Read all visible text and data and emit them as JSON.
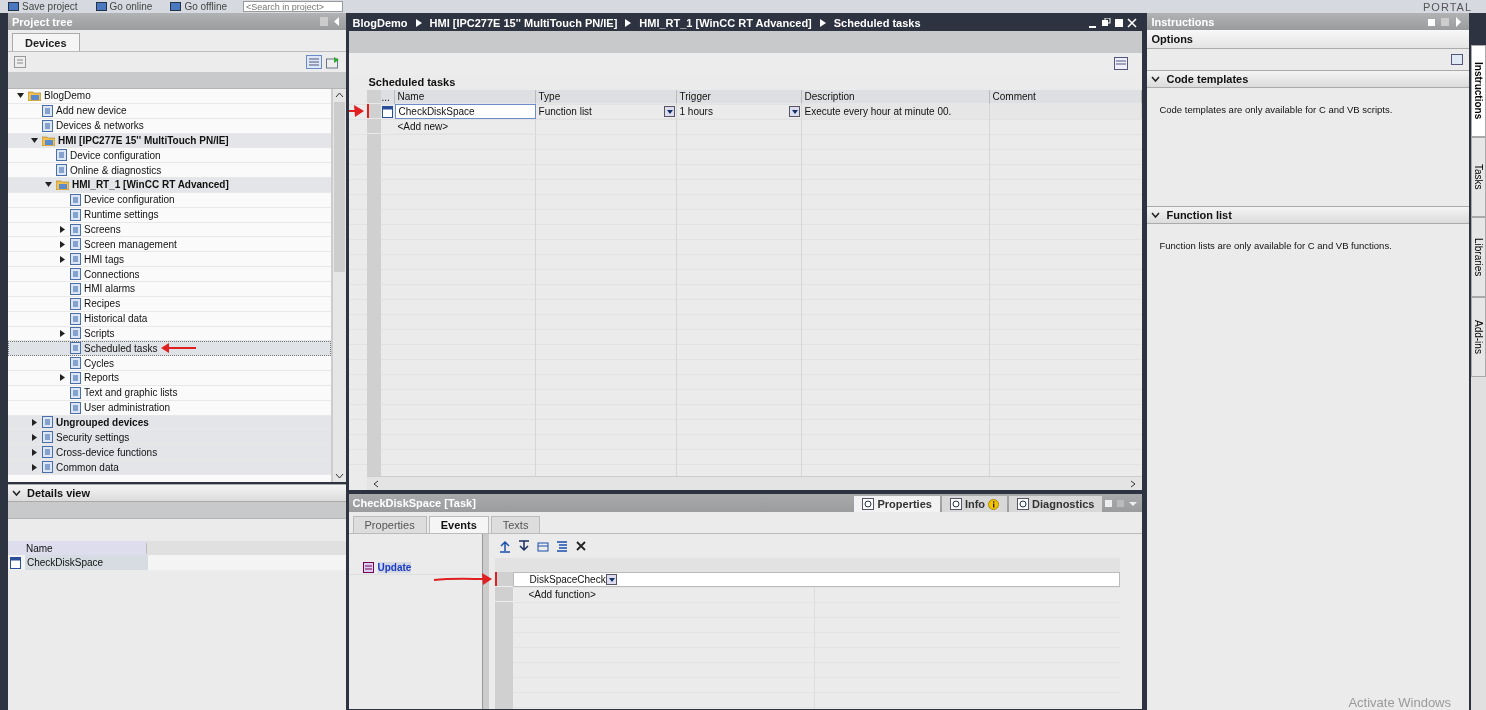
{
  "toolbar": {
    "items": [
      {
        "kind": "button",
        "label": "Save project"
      },
      {
        "kind": "button",
        "label": "Go online"
      },
      {
        "kind": "button",
        "label": "Go offline"
      },
      {
        "kind": "search",
        "placeholder": "<Search in project>"
      }
    ],
    "brand": "PORTAL"
  },
  "project_tree": {
    "title": "Project tree",
    "tabs": [
      {
        "label": "Devices",
        "selected": true
      }
    ],
    "items": [
      {
        "label": "BlogDemo",
        "expanded": true,
        "selected": false,
        "bold": false,
        "shaded": false,
        "marked": false,
        "children": [
          {
            "label": "Add new device",
            "selected": false,
            "bold": false,
            "shaded": false,
            "marked": false
          },
          {
            "label": "Devices & networks",
            "selected": false,
            "bold": false,
            "shaded": false,
            "marked": false
          },
          {
            "label": "HMI [IPC277E 15'' MultiTouch PN/IE]",
            "expanded": true,
            "selected": false,
            "bold": true,
            "shaded": true,
            "marked": false,
            "children": [
              {
                "label": "Device configuration",
                "selected": false,
                "bold": false,
                "shaded": false,
                "marked": false
              },
              {
                "label": "Online & diagnostics",
                "selected": false,
                "bold": false,
                "shaded": false,
                "marked": false
              },
              {
                "label": "HMI_RT_1 [WinCC RT Advanced]",
                "expanded": true,
                "selected": false,
                "bold": true,
                "shaded": true,
                "marked": false,
                "children": [
                  {
                    "label": "Device configuration",
                    "selected": false,
                    "bold": false,
                    "shaded": false,
                    "marked": false
                  },
                  {
                    "label": "Runtime settings",
                    "selected": false,
                    "bold": false,
                    "shaded": false,
                    "marked": false
                  },
                  {
                    "label": "Screens",
                    "expanded": false,
                    "selected": false,
                    "bold": false,
                    "shaded": false,
                    "marked": false
                  },
                  {
                    "label": "Screen management",
                    "expanded": false,
                    "selected": false,
                    "bold": false,
                    "shaded": false,
                    "marked": false
                  },
                  {
                    "label": "HMI tags",
                    "expanded": false,
                    "selected": false,
                    "bold": false,
                    "shaded": false,
                    "marked": false
                  },
                  {
                    "label": "Connections",
                    "selected": false,
                    "bold": false,
                    "shaded": false,
                    "marked": false
                  },
                  {
                    "label": "HMI alarms",
                    "selected": false,
                    "bold": false,
                    "shaded": false,
                    "marked": false
                  },
                  {
                    "label": "Recipes",
                    "selected": false,
                    "bold": false,
                    "shaded": false,
                    "marked": false
                  },
                  {
                    "label": "Historical data",
                    "selected": false,
                    "bold": false,
                    "shaded": false,
                    "marked": false
                  },
                  {
                    "label": "Scripts",
                    "expanded": false,
                    "selected": false,
                    "bold": false,
                    "shaded": false,
                    "marked": false
                  },
                  {
                    "label": "Scheduled tasks",
                    "selected": true,
                    "bold": false,
                    "shaded": false,
                    "marked": true
                  },
                  {
                    "label": "Cycles",
                    "selected": false,
                    "bold": false,
                    "shaded": false,
                    "marked": false
                  },
                  {
                    "label": "Reports",
                    "expanded": false,
                    "selected": false,
                    "bold": false,
                    "shaded": false,
                    "marked": false
                  },
                  {
                    "label": "Text and graphic lists",
                    "selected": false,
                    "bold": false,
                    "shaded": false,
                    "marked": false
                  },
                  {
                    "label": "User administration",
                    "selected": false,
                    "bold": false,
                    "shaded": false,
                    "marked": false
                  }
                ]
              }
            ]
          },
          {
            "label": "Ungrouped devices",
            "expanded": false,
            "selected": false,
            "bold": true,
            "shaded": true,
            "marked": false
          },
          {
            "label": "Security settings",
            "expanded": false,
            "selected": false,
            "bold": false,
            "shaded": true,
            "marked": false
          },
          {
            "label": "Cross-device functions",
            "expanded": false,
            "selected": false,
            "bold": false,
            "shaded": true,
            "marked": false
          },
          {
            "label": "Common data",
            "expanded": false,
            "selected": false,
            "bold": false,
            "shaded": true,
            "marked": false
          }
        ]
      }
    ]
  },
  "details_view": {
    "title": "Details view",
    "columns": [
      "Name"
    ],
    "rows": [
      {
        "name": "CheckDiskSpace",
        "selected": true
      }
    ]
  },
  "editor": {
    "breadcrumb": [
      "BlogDemo",
      "HMI [IPC277E 15'' MultiTouch PN/IE]",
      "HMI_RT_1 [WinCC RT Advanced]",
      "Scheduled tasks"
    ],
    "title": "Scheduled tasks",
    "columns": [
      "...",
      "Name",
      "Type",
      "Trigger",
      "Description",
      "Comment"
    ],
    "rows": [
      {
        "kind": "task",
        "name": "CheckDiskSpace",
        "type": "Function list",
        "trigger": "1 hours",
        "description": "Execute every hour at minute 00.",
        "comment": "",
        "marked": true
      },
      {
        "kind": "add",
        "name": "<Add new>",
        "marked": false
      }
    ]
  },
  "inspector": {
    "title": "CheckDiskSpace [Task]",
    "tabs": [
      {
        "label": "Properties",
        "selected": true,
        "badge": false
      },
      {
        "label": "Info",
        "selected": false,
        "badge": true
      },
      {
        "label": "Diagnostics",
        "selected": false,
        "badge": false
      }
    ],
    "subtabs": [
      {
        "label": "Properties",
        "selected": false
      },
      {
        "label": "Events",
        "selected": true
      },
      {
        "label": "Texts",
        "selected": false
      }
    ],
    "events": [
      {
        "label": "Update",
        "selected": true
      }
    ],
    "functions": [
      {
        "kind": "function",
        "label": "DiskSpaceCheck",
        "marked": true
      },
      {
        "kind": "add",
        "label": "<Add function>",
        "marked": false
      }
    ]
  },
  "task_card": {
    "title": "Instructions",
    "options": "Options",
    "sections": [
      {
        "title": "Code templates",
        "expanded": true,
        "text": "Code templates are only available for C and VB scripts."
      },
      {
        "title": "Function list",
        "expanded": true,
        "text": "Function lists are only available for C and VB functions."
      }
    ],
    "side_tabs": [
      {
        "label": "Instructions",
        "selected": true
      },
      {
        "label": "Tasks",
        "selected": false
      },
      {
        "label": "Libraries",
        "selected": false
      },
      {
        "label": "Add-ins",
        "selected": false
      }
    ]
  },
  "os_notice": "Activate Windows"
}
